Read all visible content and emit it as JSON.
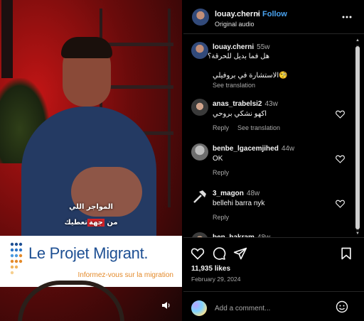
{
  "video": {
    "subtitle_line1": "المواجر اللي",
    "subtitle_line2_pre": "من ",
    "subtitle_line2_hl": "جهة",
    "subtitle_line2_post": "تعطيك",
    "banner_brand": "Le Projet Migrant.",
    "banner_tagline": "Informez-vous sur la migration"
  },
  "header": {
    "username": "louay.cherni",
    "separator": "•",
    "follow_label": "Follow",
    "audio_label": "Original audio"
  },
  "comments": [
    {
      "username": "louay.cherni",
      "time": "55w",
      "line1": "هل فما بديل للحرقة؟",
      "line2": "🧐الاستشارة في بروفيلي",
      "meta": [
        "See translation"
      ]
    },
    {
      "username": "anas_trabelsi2",
      "time": "43w",
      "text": "اكهو نشكي بروحي",
      "meta": [
        "Reply",
        "See translation"
      ]
    },
    {
      "username": "benbe_lgacemjihed",
      "time": "44w",
      "text": "OK",
      "meta": [
        "Reply"
      ]
    },
    {
      "username": "3_magon",
      "time": "48w",
      "text": "bellehi barra nyk",
      "meta": [
        "Reply"
      ]
    },
    {
      "username": "ben_bakram",
      "time": "48w",
      "text": "",
      "meta": []
    }
  ],
  "post": {
    "likes": "11,935 likes",
    "date": "February 29, 2024"
  },
  "composer": {
    "placeholder": "Add a comment..."
  },
  "colors": {
    "follow": "#4aa3f0",
    "banner_text": "#1d4f93",
    "tagline": "#e48a2a",
    "subtitle_highlight": "#d8242a"
  },
  "icons": [
    "more-icon",
    "heart-icon",
    "comment-icon",
    "share-icon",
    "bookmark-icon",
    "emoji-icon",
    "mute-icon"
  ]
}
